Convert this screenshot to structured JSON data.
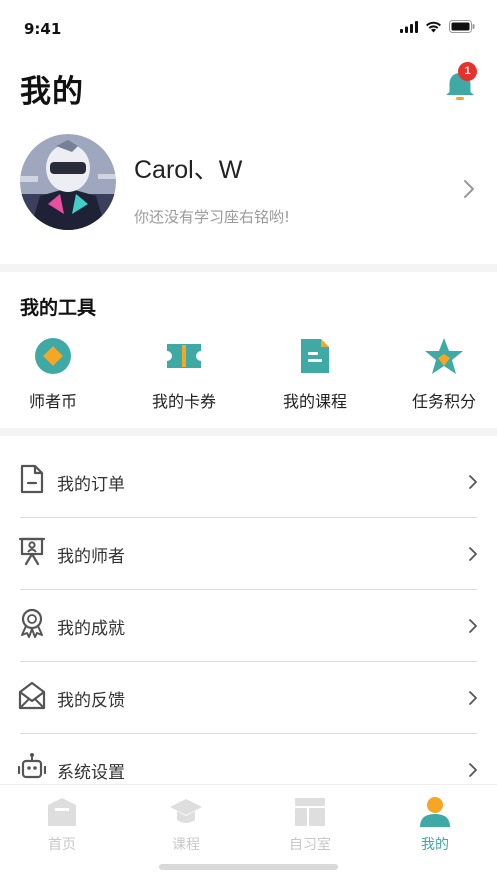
{
  "status_bar": {
    "time": "9:41"
  },
  "header": {
    "title": "我的",
    "notification_count": "1"
  },
  "profile": {
    "name": "Carol、W",
    "motto": "你还没有学习座右铭哟!"
  },
  "tools": {
    "title": "我的工具",
    "items": [
      {
        "label": "师者币",
        "icon": "coin-icon"
      },
      {
        "label": "我的卡券",
        "icon": "ticket-icon"
      },
      {
        "label": "我的课程",
        "icon": "course-doc-icon"
      },
      {
        "label": "任务积分",
        "icon": "star-icon"
      }
    ]
  },
  "menu": [
    {
      "label": "我的订单",
      "icon": "order-icon"
    },
    {
      "label": "我的师者",
      "icon": "teacher-icon"
    },
    {
      "label": "我的成就",
      "icon": "achievement-icon"
    },
    {
      "label": "我的反馈",
      "icon": "feedback-mail-icon"
    },
    {
      "label": "系统设置",
      "icon": "robot-settings-icon"
    }
  ],
  "tab_bar": [
    {
      "label": "首页",
      "icon": "home-icon",
      "active": false
    },
    {
      "label": "课程",
      "icon": "graduation-cap-icon",
      "active": false
    },
    {
      "label": "自习室",
      "icon": "study-room-icon",
      "active": false
    },
    {
      "label": "我的",
      "icon": "user-icon",
      "active": true
    }
  ],
  "colors": {
    "accent": "#3fa9a6",
    "orange": "#f5a623",
    "badge": "#e5322d",
    "muted": "#c8c8c8"
  }
}
